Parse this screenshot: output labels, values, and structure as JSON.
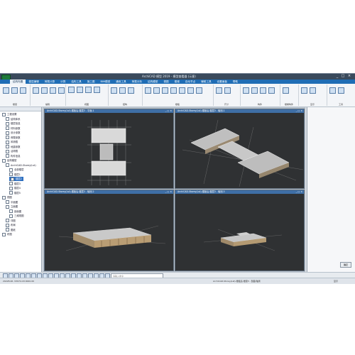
{
  "app": {
    "title": "ArchiCAD 模型 2019 - 模型查看器 (示意)",
    "window_controls": [
      "_",
      "□",
      "×"
    ]
  },
  "menu": {
    "items": [
      "结构布置",
      "楼层编辑",
      "荷载计算",
      "计算",
      "结构工具",
      "施工图",
      "BIM模型",
      "通用工具",
      "荷载分析",
      "结构模型",
      "视图",
      "楼梯",
      "自动节点",
      "辅助工具",
      "设置面板",
      "帮助"
    ]
  },
  "ribbon": {
    "groups": [
      "楼层",
      "编辑",
      "视图",
      "结构",
      "楼板",
      "尺寸",
      "构件",
      "楼梯构件",
      "显示",
      "工具"
    ]
  },
  "tree": {
    "items": [
      {
        "label": "工程设置",
        "level": 0
      },
      {
        "label": "结构体系",
        "level": 1
      },
      {
        "label": "楼层信息",
        "level": 1
      },
      {
        "label": "材料参数",
        "level": 1
      },
      {
        "label": "设计参数",
        "level": 1
      },
      {
        "label": "荷载参数",
        "level": 1
      },
      {
        "label": "风荷载",
        "level": 1
      },
      {
        "label": "地震参数",
        "level": 1
      },
      {
        "label": "活荷载",
        "level": 1
      },
      {
        "label": "构件信息",
        "level": 1
      },
      {
        "label": "结构模型",
        "level": 0
      },
      {
        "label": "ArchiCAD-Storey(Lst)",
        "level": 1
      },
      {
        "label": "全部楼层",
        "level": 2
      },
      {
        "label": "楼层1",
        "level": 2
      },
      {
        "label": "楼层2",
        "level": 2,
        "selected": true
      },
      {
        "label": "楼层3",
        "level": 2
      },
      {
        "label": "楼层4",
        "level": 2
      },
      {
        "label": "楼层5",
        "level": 2
      },
      {
        "label": "视图",
        "level": 0
      },
      {
        "label": "平面图",
        "level": 1
      },
      {
        "label": "立面图",
        "level": 1
      },
      {
        "label": "剖面图",
        "level": 2
      },
      {
        "label": "三维视图",
        "level": 2
      },
      {
        "label": "详图",
        "level": 1
      },
      {
        "label": "布局",
        "level": 1
      },
      {
        "label": "图纸",
        "level": 1
      },
      {
        "label": "布图",
        "level": 0
      }
    ]
  },
  "viewports": [
    {
      "title": "ArchiCAD-Storey(Lst)-楼板后-楼层3 - 平面-1"
    },
    {
      "title": "ArchiCAD-Storey(Lst)-楼板后-楼层3 - 轴测-1"
    },
    {
      "title": "ArchiCAD-Storey(Lst)-楼板后-楼层3 - 轴测-2"
    },
    {
      "title": "ArchiCAD-Storey(Lst)-楼板后-楼层3 - 轴测-3"
    }
  ],
  "right_panel": {
    "ok_label": "确定"
  },
  "command": {
    "placeholder": "请输入命令"
  },
  "status": {
    "coords": "29228.46  -53974.18  0000.00",
    "view_info": "ArchiCAD-Storey(Lst)-楼板后-楼层3 - 剖面/轴测",
    "right": "显示"
  },
  "colors": {
    "menubar": "#1f6db5",
    "viewport_bg": "#2f3133",
    "selected_row": "#2e6fc0"
  }
}
